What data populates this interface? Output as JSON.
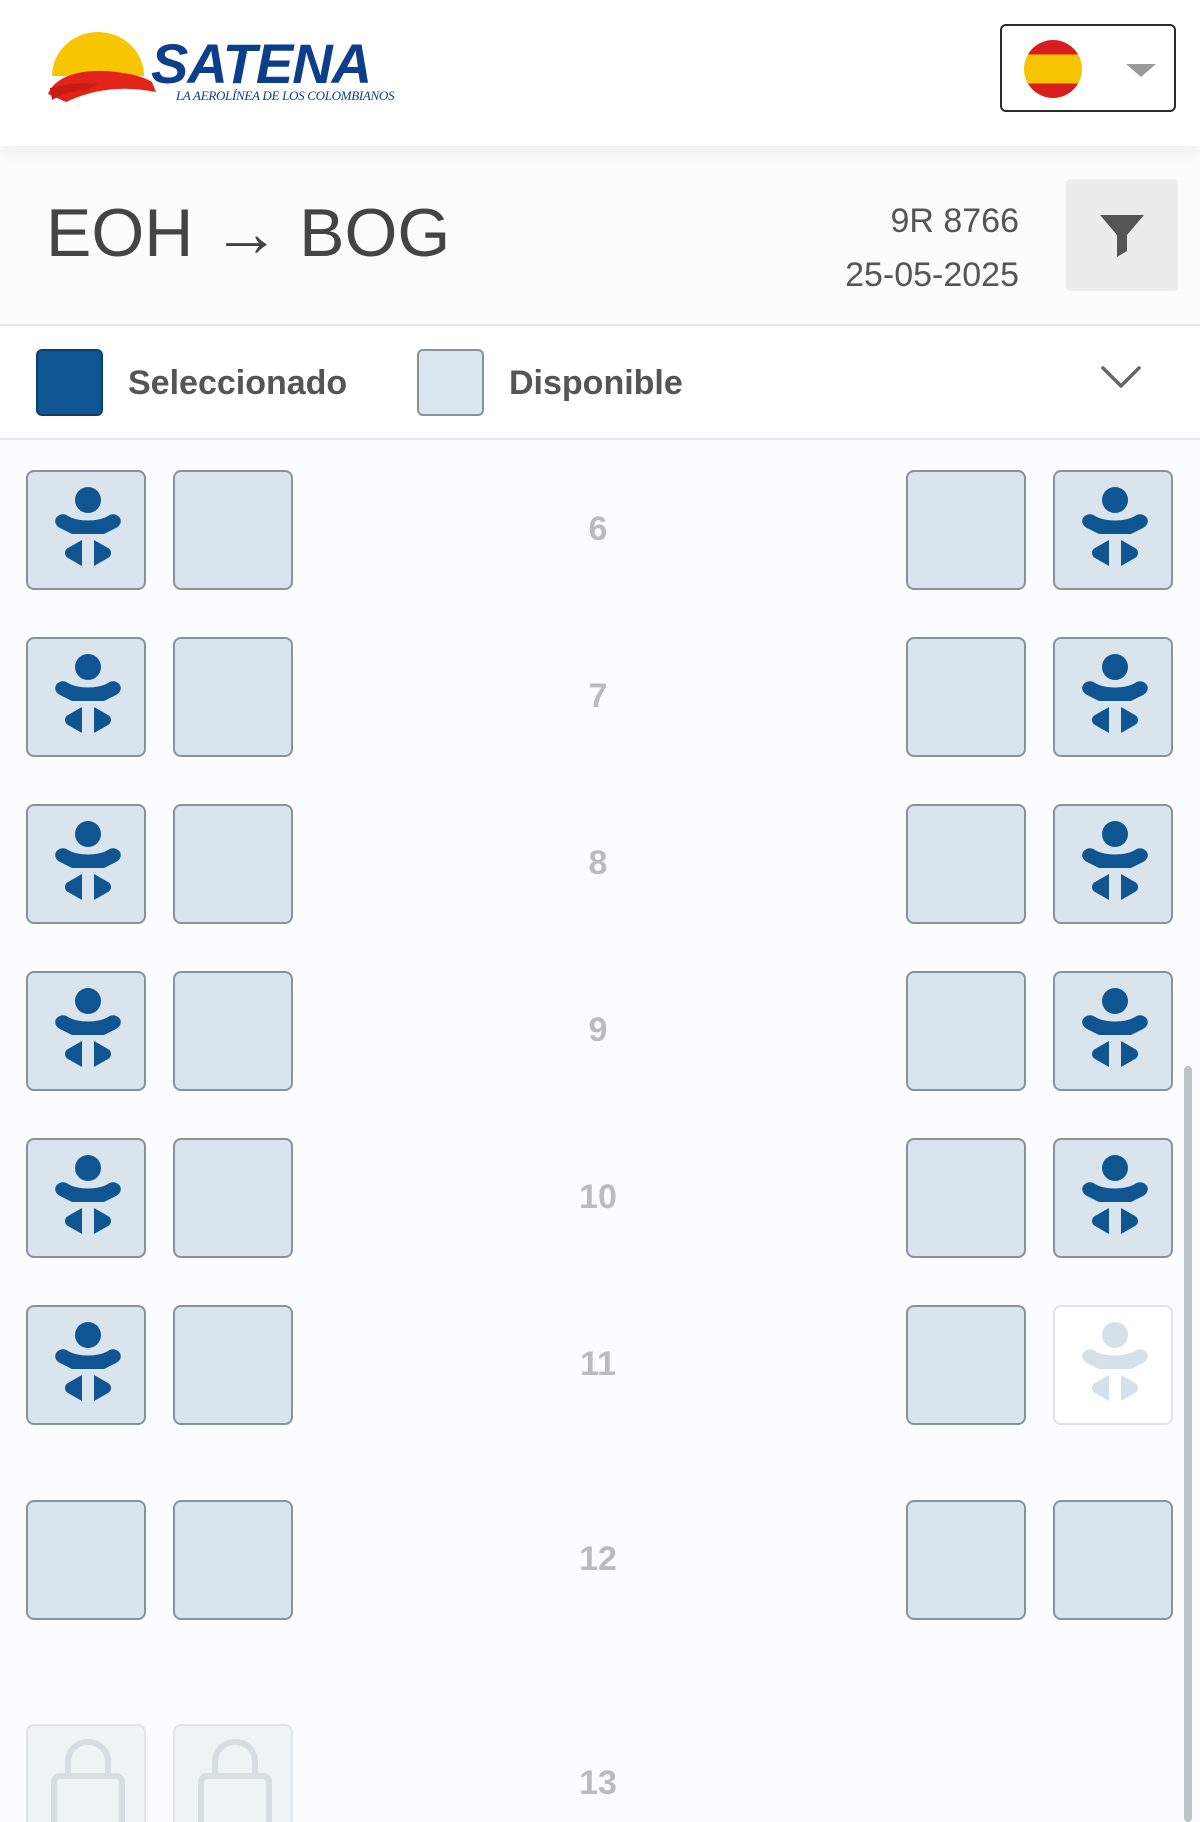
{
  "header": {
    "logo_text": "SATENA",
    "logo_tagline": "LA AEROLÍNEA DE LOS COLOMBIANOS",
    "language_icon": "spain-flag-icon"
  },
  "flight": {
    "route": "EOH → BOG",
    "number": "9R 8766",
    "date": "25-05-2025",
    "filter_icon": "filter-icon"
  },
  "legend": {
    "selected_label": "Seleccionado",
    "available_label": "Disponible",
    "colors": {
      "selected": "#0e5592",
      "available": "#dae5ee"
    }
  },
  "rows": [
    {
      "number": "6",
      "seats": [
        "infant",
        "available",
        "available",
        "infant"
      ]
    },
    {
      "number": "7",
      "seats": [
        "infant",
        "available",
        "available",
        "infant"
      ]
    },
    {
      "number": "8",
      "seats": [
        "infant",
        "available",
        "available",
        "infant"
      ]
    },
    {
      "number": "9",
      "seats": [
        "infant",
        "available",
        "available",
        "infant"
      ]
    },
    {
      "number": "10",
      "seats": [
        "infant",
        "available",
        "available",
        "infant"
      ]
    },
    {
      "number": "11",
      "seats": [
        "infant",
        "available",
        "available",
        "infant-disabled"
      ]
    },
    {
      "number": "12",
      "seats": [
        "available",
        "available",
        "available",
        "available"
      ]
    },
    {
      "number": "13",
      "seats": [
        "locked",
        "locked"
      ]
    }
  ]
}
